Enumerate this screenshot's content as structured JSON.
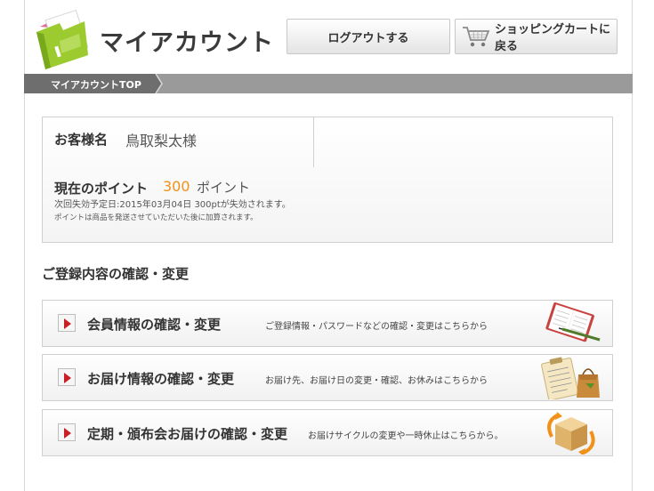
{
  "header": {
    "title": "マイアカウント",
    "logout_label": "ログアウトする",
    "cart_label": "ショッピングカートに戻る"
  },
  "breadcrumb": {
    "current": "マイアカウントTOP"
  },
  "customer": {
    "name_label": "お客様名",
    "name_value": "鳥取梨太様",
    "points_label": "現在のポイント",
    "points_value": "300",
    "points_unit": "ポイント",
    "expire_note": "次回失効予定日:2015年03月04日 300ptが失効されます。",
    "add_note": "ポイントは商品を発送させていただいた後に加算されます。"
  },
  "registration": {
    "heading": "ご登録内容の確認・変更",
    "items": [
      {
        "title": "会員情報の確認・変更",
        "description": "ご登録情報・パスワードなどの確認・変更はこちらから",
        "icon": "notebook-pen-icon"
      },
      {
        "title": "お届け情報の確認・変更",
        "description": "お届け先、お届け日の変更・確認、お休みはこちらから",
        "icon": "clipboard-bag-icon"
      },
      {
        "title": "定期・頒布会お届けの確認・変更",
        "description": "お届けサイクルの変更や一時休止はこちらから。",
        "icon": "box-cycle-icon"
      }
    ]
  },
  "colors": {
    "accent_orange": "#f29118",
    "arrow_red": "#c81e24",
    "logo_green": "#8fc31f",
    "breadcrumb_gray": "#9a9a9a"
  }
}
